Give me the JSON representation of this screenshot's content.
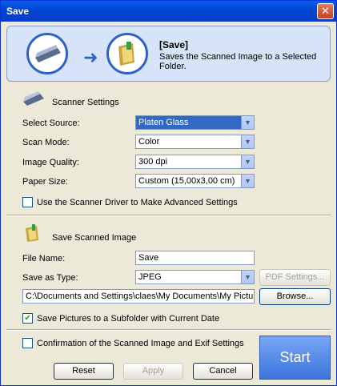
{
  "window": {
    "title": "Save",
    "close_glyph": "✕",
    "accent": "#0A5FE8"
  },
  "banner": {
    "heading": "[Save]",
    "description": "Saves the Scanned Image to a Selected Folder.",
    "icons": [
      "scanner-icon",
      "arrow-right-icon",
      "save-folder-icon"
    ]
  },
  "scanner_settings": {
    "heading": "Scanner Settings",
    "fields": [
      {
        "label": "Select Source:",
        "accel": "o",
        "value": "Platen Glass"
      },
      {
        "label": "Scan Mode:",
        "accel": "S",
        "value": "Color"
      },
      {
        "label": "Image Quality:",
        "accel": "Q",
        "value": "300 dpi"
      },
      {
        "label": "Paper Size:",
        "accel": "P",
        "value": "Custom (15,00x3,00 cm)"
      }
    ],
    "advanced_checkbox": {
      "label": "Use the Scanner Driver to Make Advanced Settings",
      "checked": false
    }
  },
  "save_image": {
    "heading": "Save Scanned Image",
    "file_name_label": "File Name:",
    "file_name_value": "Save",
    "save_as_type_label": "Save as Type:",
    "save_as_type_value": "JPEG",
    "pdf_settings_label": "PDF Settings...",
    "path_value": "C:\\Documents and Settings\\claes\\My Documents\\My Pictures",
    "browse_label": "Browse...",
    "subfolder_checkbox": {
      "label": "Save Pictures to a Subfolder with Current Date",
      "checked": true
    }
  },
  "footer": {
    "confirm_checkbox": {
      "label": "Confirmation of the Scanned Image and Exif Settings",
      "checked": false
    },
    "reset_label": "Reset",
    "apply_label": "Apply",
    "cancel_label": "Cancel",
    "start_label": "Start"
  },
  "check_glyph": "✔",
  "dropdown_glyph": "▼"
}
